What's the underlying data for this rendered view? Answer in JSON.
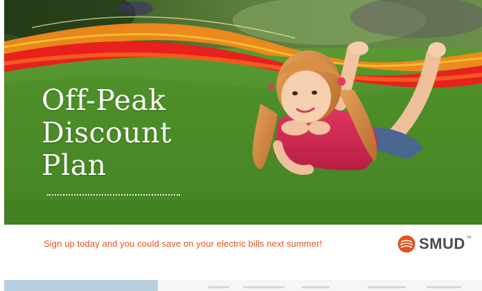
{
  "headline": {
    "line1": "Off-Peak",
    "line2": "Discount",
    "line3": "Plan"
  },
  "cta_text": "Sign up today and you could save on your electric bills next summer!",
  "logo": {
    "name": "SMUD",
    "tm": "™"
  },
  "colors": {
    "accent_orange": "#e2531f",
    "swoosh_red": "#e8201e",
    "grass_green": "#4f8f2c",
    "logo_gray": "#4a4a4a"
  }
}
